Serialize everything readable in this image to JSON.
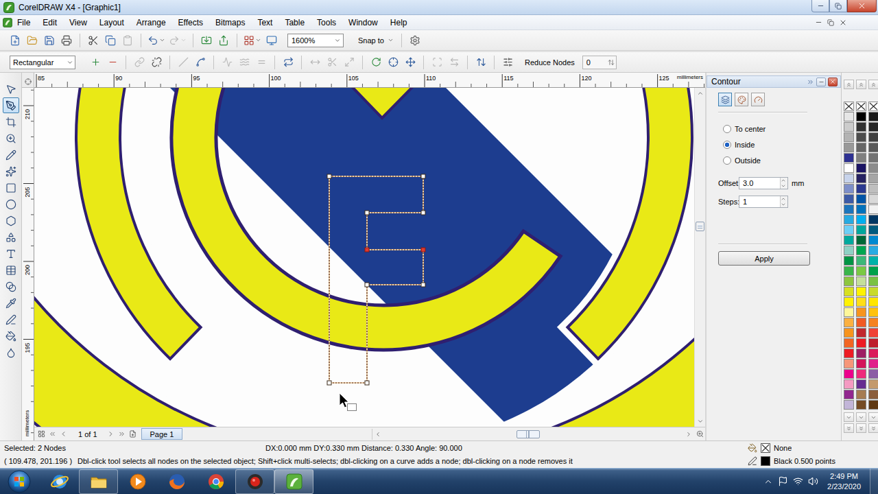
{
  "window": {
    "title": "CorelDRAW X4 - [Graphic1]"
  },
  "menu": [
    "File",
    "Edit",
    "View",
    "Layout",
    "Arrange",
    "Effects",
    "Bitmaps",
    "Text",
    "Table",
    "Tools",
    "Window",
    "Help"
  ],
  "standard_toolbar": {
    "buttons": [
      {
        "kind": "new",
        "disabled": false,
        "dropdown": false
      },
      {
        "kind": "open",
        "disabled": false,
        "dropdown": false
      },
      {
        "kind": "save",
        "disabled": false,
        "dropdown": false
      },
      {
        "kind": "print",
        "disabled": false,
        "dropdown": false
      },
      {
        "kind": "separator"
      },
      {
        "kind": "cut",
        "disabled": false,
        "dropdown": false
      },
      {
        "kind": "copy",
        "disabled": false,
        "dropdown": false
      },
      {
        "kind": "paste",
        "disabled": true,
        "dropdown": false
      },
      {
        "kind": "separator"
      },
      {
        "kind": "undo",
        "disabled": false,
        "dropdown": true
      },
      {
        "kind": "redo",
        "disabled": true,
        "dropdown": true
      },
      {
        "kind": "separator"
      },
      {
        "kind": "import",
        "disabled": false,
        "dropdown": false
      },
      {
        "kind": "export",
        "disabled": false,
        "dropdown": false
      },
      {
        "kind": "separator"
      },
      {
        "kind": "launcher",
        "disabled": false,
        "dropdown": true
      },
      {
        "kind": "welcome",
        "disabled": false,
        "dropdown": false
      }
    ],
    "zoom": "1600%",
    "snap": "Snap to",
    "trailing_buttons": [
      {
        "kind": "options",
        "disabled": false,
        "dropdown": false
      }
    ]
  },
  "property_bar": {
    "mode": "Rectangular",
    "buttons": [
      {
        "kind": "add-node",
        "disabled": false
      },
      {
        "kind": "delete-node",
        "disabled": false
      },
      {
        "kind": "separator"
      },
      {
        "kind": "join",
        "disabled": true
      },
      {
        "kind": "break",
        "disabled": false
      },
      {
        "kind": "separator"
      },
      {
        "kind": "to-line",
        "disabled": true
      },
      {
        "kind": "to-curve",
        "disabled": false
      },
      {
        "kind": "separator"
      },
      {
        "kind": "cusp",
        "disabled": true
      },
      {
        "kind": "smooth",
        "disabled": true
      },
      {
        "kind": "symmetrical",
        "disabled": true
      },
      {
        "kind": "separator"
      },
      {
        "kind": "reverse",
        "disabled": false
      },
      {
        "kind": "separator"
      },
      {
        "kind": "extend",
        "disabled": true
      },
      {
        "kind": "extract",
        "disabled": true
      },
      {
        "kind": "stretch",
        "disabled": true
      },
      {
        "kind": "separator"
      },
      {
        "kind": "rotate",
        "disabled": false
      },
      {
        "kind": "align",
        "disabled": false
      },
      {
        "kind": "elastic",
        "disabled": false
      },
      {
        "kind": "separator"
      },
      {
        "kind": "select-all",
        "disabled": true
      },
      {
        "kind": "reflect-h",
        "disabled": true
      },
      {
        "kind": "separator"
      },
      {
        "kind": "reflect-v",
        "disabled": false
      },
      {
        "kind": "separator"
      },
      {
        "kind": "reduce-options",
        "disabled": false
      }
    ],
    "reduce_label": "Reduce Nodes",
    "reduce_value": "0"
  },
  "toolbox": [
    {
      "kind": "pick",
      "selected": false
    },
    {
      "kind": "shape",
      "selected": true
    },
    {
      "kind": "crop",
      "selected": false
    },
    {
      "kind": "zoom",
      "selected": false
    },
    {
      "kind": "freehand",
      "selected": false
    },
    {
      "kind": "smart-fill",
      "selected": false
    },
    {
      "kind": "rectangle",
      "selected": false
    },
    {
      "kind": "ellipse",
      "selected": false
    },
    {
      "kind": "polygon",
      "selected": false
    },
    {
      "kind": "basic-shapes",
      "selected": false
    },
    {
      "kind": "text",
      "selected": false
    },
    {
      "kind": "table",
      "selected": false
    },
    {
      "kind": "blend",
      "selected": false
    },
    {
      "kind": "eyedropper",
      "selected": false
    },
    {
      "kind": "outline",
      "selected": false
    },
    {
      "kind": "fill",
      "selected": false
    },
    {
      "kind": "interactive-fill",
      "selected": false
    }
  ],
  "rulers": {
    "horizontal": {
      "ticks": [
        "85",
        "90",
        "95",
        "100",
        "105",
        "110",
        "115",
        "120",
        "125"
      ],
      "unit": "millimeters"
    },
    "vertical": {
      "ticks": [
        "210",
        "205",
        "200",
        "195"
      ],
      "unit": "millimeters"
    }
  },
  "canvas": {
    "selection": {
      "nodes": [
        {
          "selected": false
        },
        {
          "selected": false
        },
        {
          "selected": false
        },
        {
          "selected": false
        },
        {
          "selected": true
        },
        {
          "selected": true
        },
        {
          "selected": false
        },
        {
          "selected": false
        },
        {
          "selected": false
        },
        {
          "selected": false
        }
      ]
    }
  },
  "scroll": {
    "vertical": {
      "level": 0.4
    },
    "horizontal": {
      "level": 0.48
    }
  },
  "page_nav": {
    "position": "1 of 1",
    "tabs": [
      {
        "label": "Page 1",
        "selected": true
      }
    ]
  },
  "docker": {
    "title": "Contour",
    "tabs": [
      {
        "kind": "steps",
        "selected": true
      },
      {
        "kind": "colors",
        "selected": false
      },
      {
        "kind": "acceleration",
        "selected": false
      }
    ],
    "direction": [
      {
        "label": "To center",
        "selected": false
      },
      {
        "label": "Inside",
        "selected": true
      },
      {
        "label": "Outside",
        "selected": false
      }
    ],
    "offset": {
      "label": "Offset:",
      "value": "3.0",
      "unit": "mm"
    },
    "steps": {
      "label": "Steps:",
      "value": "1"
    },
    "apply": "Apply"
  },
  "palette": {
    "columns": [
      [
        {
          "kind": "none"
        },
        {
          "kind": "swatch",
          "color": "#e6e6e6"
        },
        {
          "kind": "swatch",
          "color": "#cccccc"
        },
        {
          "kind": "swatch",
          "color": "#b3b3b3"
        },
        {
          "kind": "swatch",
          "color": "#999999"
        },
        {
          "kind": "swatch",
          "color": "#2e3192"
        },
        {
          "kind": "swatch",
          "color": "#ffffff"
        },
        {
          "kind": "swatch",
          "color": "#c7d3eb"
        },
        {
          "kind": "swatch",
          "color": "#7d8fc9"
        },
        {
          "kind": "swatch",
          "color": "#3c5aa6"
        },
        {
          "kind": "swatch",
          "color": "#1c75bc"
        },
        {
          "kind": "swatch",
          "color": "#27aae1"
        },
        {
          "kind": "swatch",
          "color": "#6dcff6"
        },
        {
          "kind": "swatch",
          "color": "#00a99d"
        },
        {
          "kind": "swatch",
          "color": "#8fd1c4"
        },
        {
          "kind": "swatch",
          "color": "#009444"
        },
        {
          "kind": "swatch",
          "color": "#39b54a"
        },
        {
          "kind": "swatch",
          "color": "#8dc63f"
        },
        {
          "kind": "swatch",
          "color": "#d7e021"
        },
        {
          "kind": "swatch",
          "color": "#fff200"
        },
        {
          "kind": "swatch",
          "color": "#fff799"
        },
        {
          "kind": "swatch",
          "color": "#fbb040"
        },
        {
          "kind": "swatch",
          "color": "#f7941d"
        },
        {
          "kind": "swatch",
          "color": "#f26522"
        },
        {
          "kind": "swatch",
          "color": "#ed1c24"
        },
        {
          "kind": "swatch",
          "color": "#f69679"
        },
        {
          "kind": "swatch",
          "color": "#ec008c"
        },
        {
          "kind": "swatch",
          "color": "#f49ac2"
        },
        {
          "kind": "swatch",
          "color": "#92278f"
        },
        {
          "kind": "swatch",
          "color": "#c2b5d8"
        }
      ],
      [
        {
          "kind": "none"
        },
        {
          "kind": "swatch",
          "color": "#000000"
        },
        {
          "kind": "swatch",
          "color": "#333333"
        },
        {
          "kind": "swatch",
          "color": "#4d4d4d"
        },
        {
          "kind": "swatch",
          "color": "#666666"
        },
        {
          "kind": "swatch",
          "color": "#808080"
        },
        {
          "kind": "swatch",
          "color": "#1b1464"
        },
        {
          "kind": "swatch",
          "color": "#262262"
        },
        {
          "kind": "swatch",
          "color": "#2b3990"
        },
        {
          "kind": "swatch",
          "color": "#0054a6"
        },
        {
          "kind": "swatch",
          "color": "#0072bc"
        },
        {
          "kind": "swatch",
          "color": "#00aeef"
        },
        {
          "kind": "swatch",
          "color": "#00a79d"
        },
        {
          "kind": "swatch",
          "color": "#006838"
        },
        {
          "kind": "swatch",
          "color": "#00a651"
        },
        {
          "kind": "swatch",
          "color": "#3cb878"
        },
        {
          "kind": "swatch",
          "color": "#7ac943"
        },
        {
          "kind": "swatch",
          "color": "#c4df9b"
        },
        {
          "kind": "swatch",
          "color": "#fff200"
        },
        {
          "kind": "swatch",
          "color": "#ffde17"
        },
        {
          "kind": "swatch",
          "color": "#f7941d"
        },
        {
          "kind": "swatch",
          "color": "#f15a24"
        },
        {
          "kind": "swatch",
          "color": "#c1272d"
        },
        {
          "kind": "swatch",
          "color": "#ed1c24"
        },
        {
          "kind": "swatch",
          "color": "#9e1f63"
        },
        {
          "kind": "swatch",
          "color": "#d4145a"
        },
        {
          "kind": "swatch",
          "color": "#ee2a7b"
        },
        {
          "kind": "swatch",
          "color": "#662d91"
        },
        {
          "kind": "swatch",
          "color": "#a67c52"
        },
        {
          "kind": "swatch",
          "color": "#754c24"
        }
      ],
      [
        {
          "kind": "none"
        },
        {
          "kind": "swatch",
          "color": "#1a1a1a"
        },
        {
          "kind": "swatch",
          "color": "#262626"
        },
        {
          "kind": "swatch",
          "color": "#404040"
        },
        {
          "kind": "swatch",
          "color": "#595959"
        },
        {
          "kind": "swatch",
          "color": "#737373"
        },
        {
          "kind": "swatch",
          "color": "#8c8c8c"
        },
        {
          "kind": "swatch",
          "color": "#a6a6a6"
        },
        {
          "kind": "swatch",
          "color": "#bfbfbf"
        },
        {
          "kind": "swatch",
          "color": "#d9d9d9"
        },
        {
          "kind": "swatch",
          "color": "#f2f2f2"
        },
        {
          "kind": "swatch",
          "color": "#003663"
        },
        {
          "kind": "swatch",
          "color": "#005b7f"
        },
        {
          "kind": "swatch",
          "color": "#0089d0"
        },
        {
          "kind": "swatch",
          "color": "#29abe2"
        },
        {
          "kind": "swatch",
          "color": "#00b2a9"
        },
        {
          "kind": "swatch",
          "color": "#00a14b"
        },
        {
          "kind": "swatch",
          "color": "#7ac143"
        },
        {
          "kind": "swatch",
          "color": "#c8da2b"
        },
        {
          "kind": "swatch",
          "color": "#ffe600"
        },
        {
          "kind": "swatch",
          "color": "#ffc20e"
        },
        {
          "kind": "swatch",
          "color": "#f58220"
        },
        {
          "kind": "swatch",
          "color": "#ef4136"
        },
        {
          "kind": "swatch",
          "color": "#be1e2d"
        },
        {
          "kind": "swatch",
          "color": "#da1c5c"
        },
        {
          "kind": "swatch",
          "color": "#e0218a"
        },
        {
          "kind": "swatch",
          "color": "#8b5ca5"
        },
        {
          "kind": "swatch",
          "color": "#c49a6c"
        },
        {
          "kind": "swatch",
          "color": "#8b5e3c"
        },
        {
          "kind": "swatch",
          "color": "#603913"
        }
      ]
    ]
  },
  "status_bar": {
    "selection": "Selected: 2 Nodes",
    "measure": "DX:0.000 mm DY:0.330 mm Distance: 0.330 Angle: 90.000",
    "coords": "( 109.478, 201.196 )",
    "hint": "Dbl-click tool selects all nodes on the selected object; Shift+click multi-selects; dbl-clicking on a curve adds a node; dbl-clicking on a node removes it",
    "fill": {
      "kind": "none",
      "label": "None"
    },
    "outline": {
      "kind": "solid",
      "color": "#000000",
      "label": "Black 0.500 points"
    }
  },
  "taskbar": {
    "apps": [
      {
        "kind": "ie",
        "running": false,
        "selected": false
      },
      {
        "kind": "explorer",
        "running": true,
        "selected": false
      },
      {
        "kind": "media",
        "running": false,
        "selected": false
      },
      {
        "kind": "firefox",
        "running": false,
        "selected": false
      },
      {
        "kind": "chrome",
        "running": false,
        "selected": false
      },
      {
        "kind": "recorder",
        "running": true,
        "selected": false
      },
      {
        "kind": "coreldraw",
        "running": true,
        "selected": true
      }
    ],
    "time": "2:49 PM",
    "date": "2/23/2020"
  }
}
